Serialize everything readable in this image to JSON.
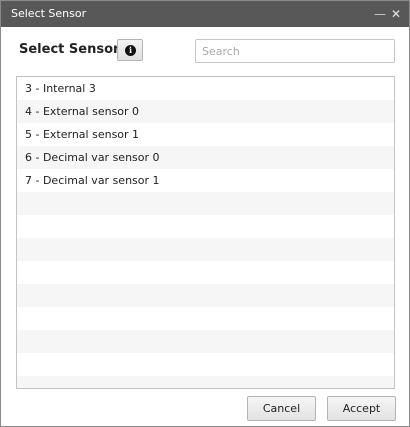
{
  "window": {
    "title": "Select Sensor",
    "minimize_icon": "minimize-icon",
    "close_icon": "close-icon"
  },
  "header": {
    "title": "Select Sensor",
    "info_icon": "info-icon"
  },
  "search": {
    "placeholder": "Search",
    "value": ""
  },
  "sensors": [
    "3 - Internal 3",
    "4 - External sensor 0",
    "5 - External sensor 1",
    "6 - Decimal var sensor 0",
    "7 - Decimal var sensor 1"
  ],
  "footer": {
    "cancel_label": "Cancel",
    "accept_label": "Accept"
  }
}
